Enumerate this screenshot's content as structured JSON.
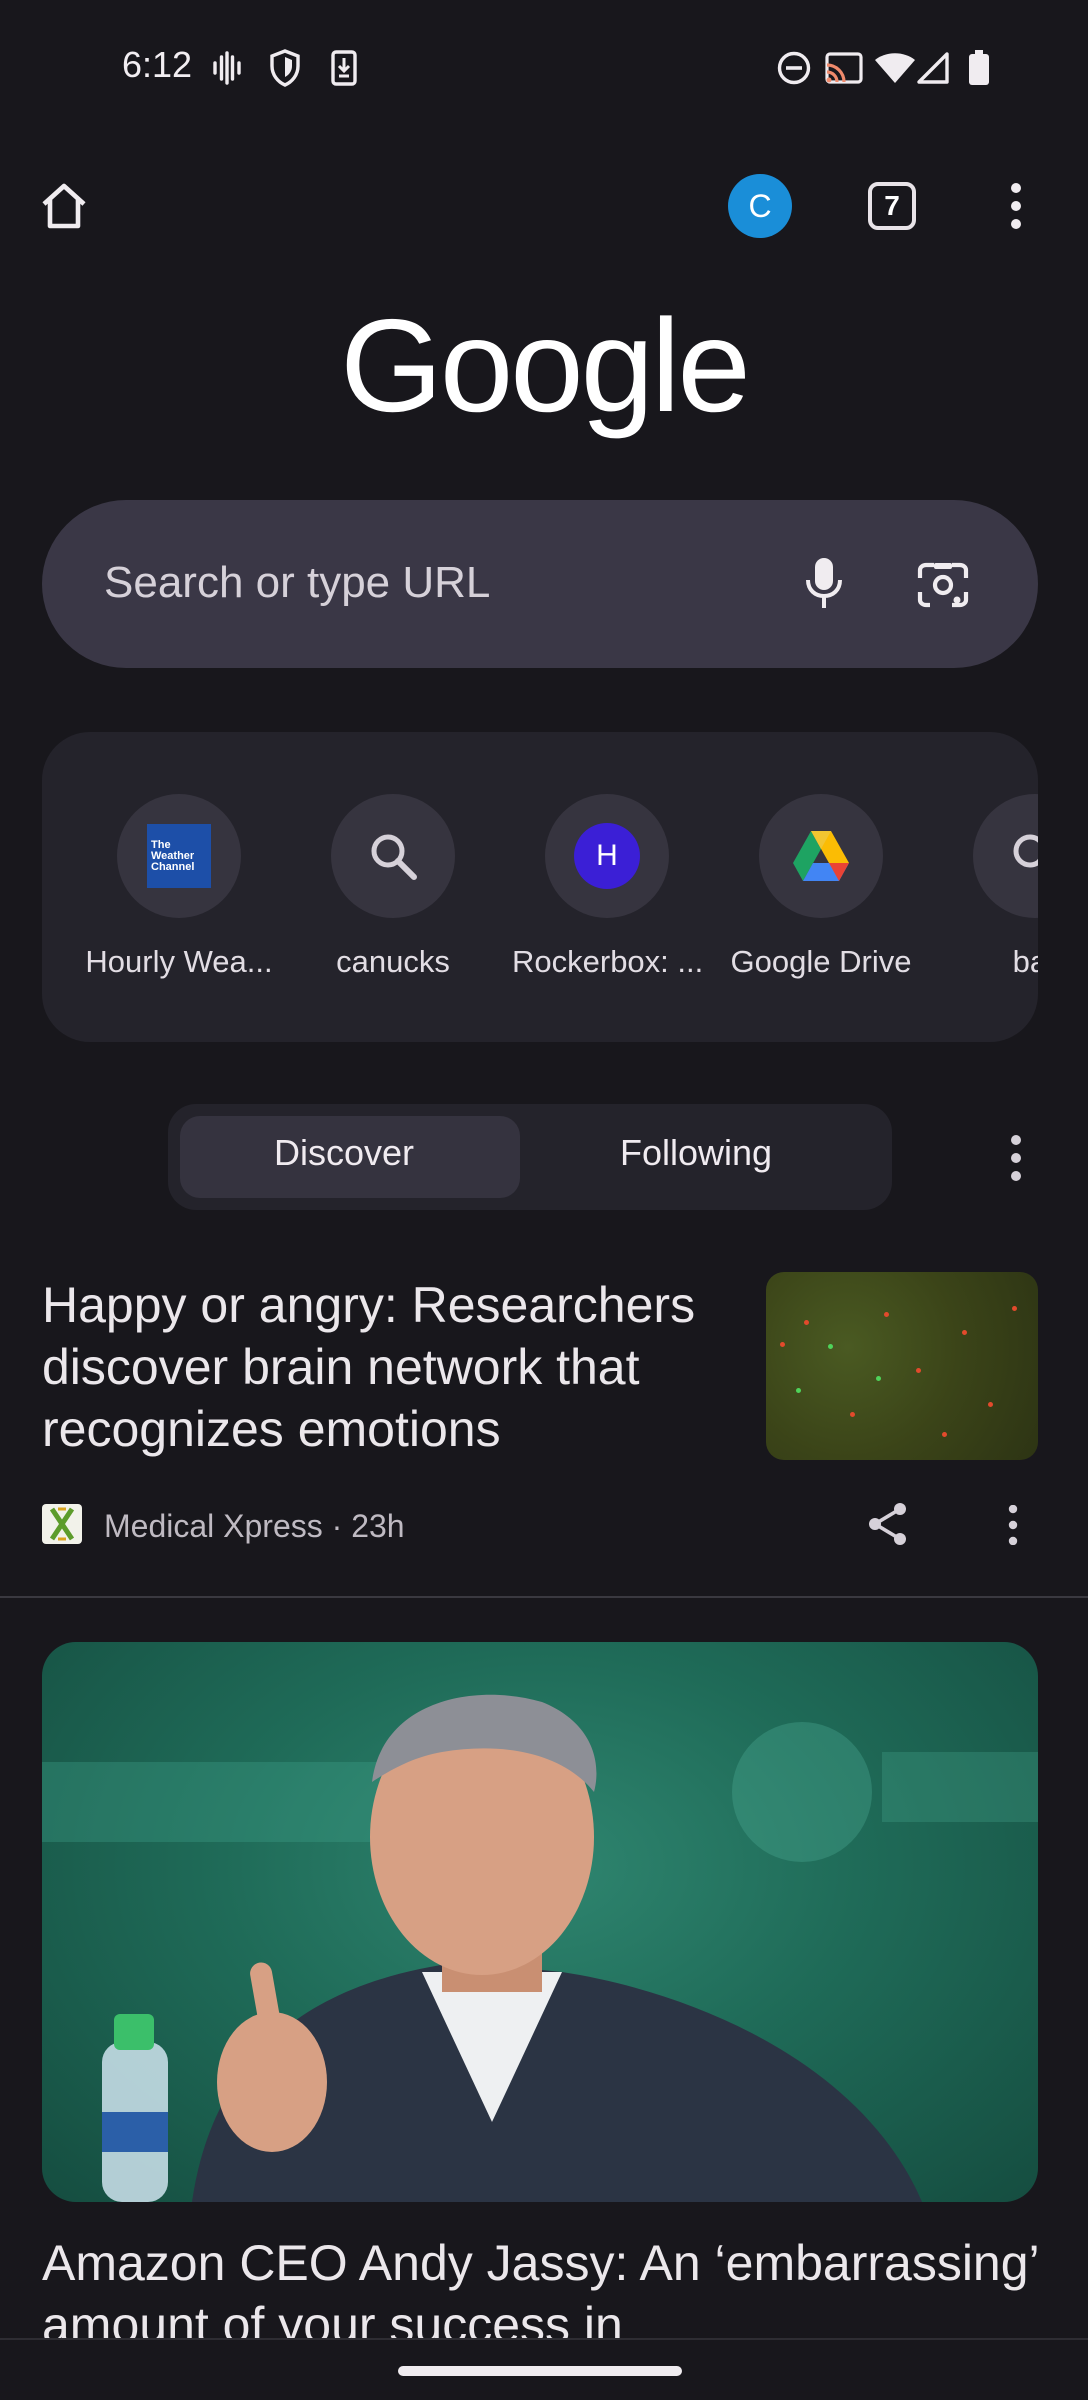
{
  "status_bar": {
    "time": "6:12",
    "left_icons": [
      "vibrate-icon",
      "shield-icon",
      "download-icon"
    ],
    "right_icons": [
      "do-not-disturb-icon",
      "cast-icon",
      "wifi-icon",
      "cell-signal-icon",
      "battery-icon"
    ]
  },
  "toolbar": {
    "avatar_initial": "C",
    "tab_count": "7"
  },
  "logo": {
    "text": "Google"
  },
  "search": {
    "placeholder": "Search or type URL"
  },
  "shortcuts": [
    {
      "label": "Hourly Wea...",
      "icon": "weather-channel-icon",
      "icon_text": "The Weather Channel"
    },
    {
      "label": "canucks",
      "icon": "search-icon"
    },
    {
      "label": "Rockerbox: ...",
      "icon": "letter-h-icon",
      "icon_text": "H"
    },
    {
      "label": "Google Drive",
      "icon": "google-drive-icon"
    },
    {
      "label": "bar",
      "icon": "search-icon"
    }
  ],
  "feed_tabs": {
    "discover": "Discover",
    "following": "Following"
  },
  "articles": [
    {
      "title": "Happy or angry: Researchers discover brain network that recognizes emotions",
      "source": "Medical Xpress · 23h",
      "source_icon": "medical-xpress-icon"
    },
    {
      "title": "Amazon CEO Andy Jassy: An ‘embarrassing’ amount of your success in"
    }
  ],
  "colors": {
    "background": "#18171c",
    "search_bg": "#3a3746",
    "avatar": "#1a8ed8",
    "rockerbox": "#3b1fd6"
  }
}
